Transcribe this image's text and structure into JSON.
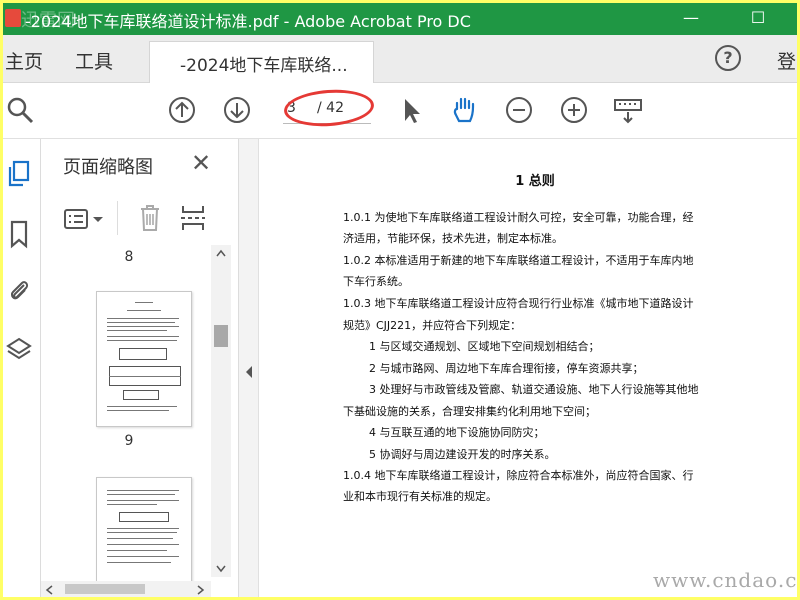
{
  "window": {
    "title": "-2024地下车库联络道设计标准.pdf - Adobe Acrobat Pro DC",
    "minimize_glyph": "—",
    "maximize_glyph": "☐",
    "watermark_logo_text": "迅雷网"
  },
  "tabs": {
    "home": "主页",
    "tools": "工具",
    "document": "-2024地下车库联络...",
    "help_glyph": "?",
    "login": "登"
  },
  "toolbar": {
    "current_page": "3",
    "total_pages": "/ 42",
    "icons": [
      "search-icon",
      "page-up-icon",
      "page-down-icon",
      "select-cursor-icon",
      "hand-icon",
      "zoom-out-icon",
      "zoom-in-icon",
      "keyboard-icon"
    ]
  },
  "left_rail": {
    "icons": [
      "page-thumbnails-icon",
      "bookmark-icon",
      "attachment-icon",
      "layers-icon"
    ]
  },
  "thumbnail_panel": {
    "title": "页面缩略图",
    "close_glyph": "✕",
    "pages": [
      {
        "label": "8"
      },
      {
        "label": "9"
      }
    ]
  },
  "document": {
    "heading": "1 总则",
    "lines": [
      "1.0.1 为使地下车库联络道工程设计耐久可控，安全可靠，功能合理，经",
      "济适用，节能环保，技术先进，制定本标准。",
      "1.0.2 本标准适用于新建的地下车库联络道工程设计，不适用于车库内地",
      "下车行系统。",
      "1.0.3 地下车库联络道工程设计应符合现行行业标准《城市地下道路设计",
      "规范》CJJ221，并应符合下列规定：",
      "1 与区域交通规划、区域地下空间规划相结合；",
      "2 与城市路网、周边地下车库合理衔接，停车资源共享；",
      "3 处理好与市政管线及管廊、轨道交通设施、地下人行设施等其他地",
      "下基础设施的关系，合理安排集约化利用地下空间；",
      "4 与互联互通的地下设施协同防灾；",
      "5 协调好与周边建设开发的时序关系。",
      "1.0.4 地下车库联络道工程设计，除应符合本标准外，尚应符合国家、行",
      "业和本市现行有关标准的规定。"
    ]
  },
  "watermark": "www.cndao.com",
  "colors": {
    "title_bar": "#1f9744",
    "highlight_ellipse": "#e53935",
    "outer_frame": "#ffff66"
  }
}
